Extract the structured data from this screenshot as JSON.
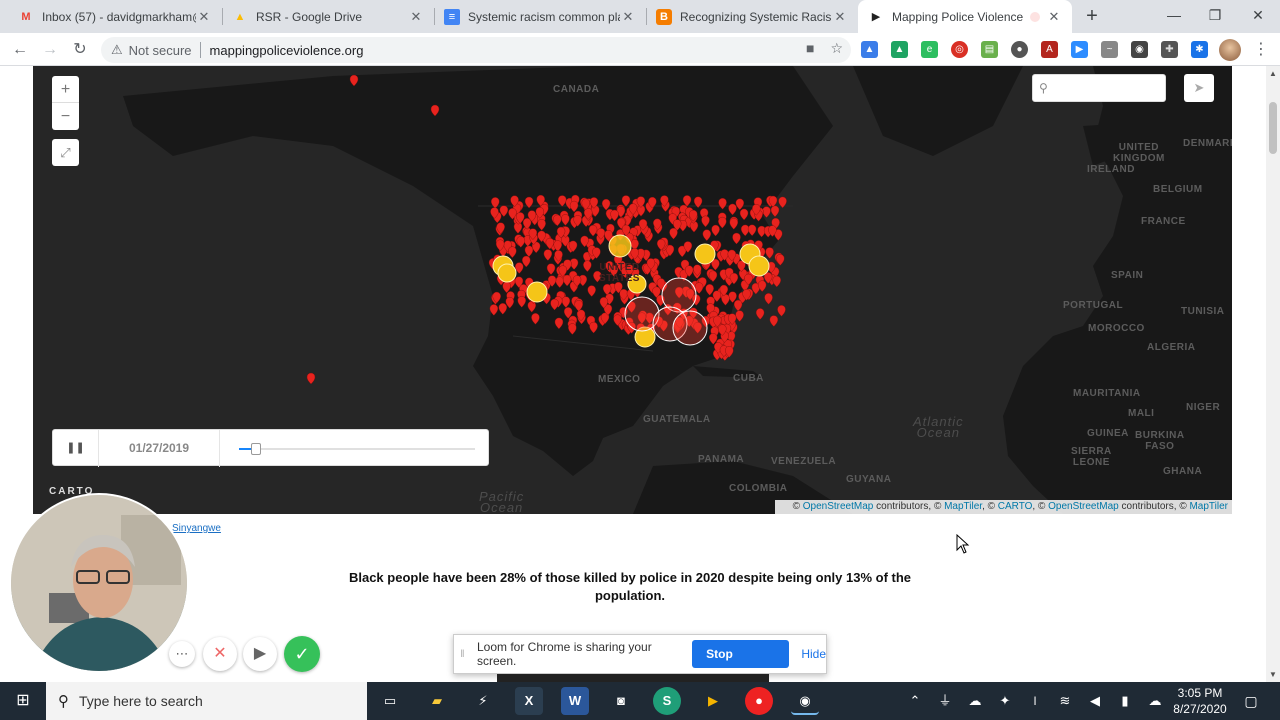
{
  "browser": {
    "tabs": [
      {
        "title": "Inbox (57) - davidgmarkham@",
        "icon": "gmail-icon",
        "favicon_text": "M",
        "favicon_color": "#ea4335"
      },
      {
        "title": "RSR - Google Drive",
        "icon": "google-drive-icon",
        "favicon_text": "▲",
        "favicon_color": "#fbbc04"
      },
      {
        "title": "Systemic racism common plac",
        "icon": "google-docs-icon",
        "favicon_text": "≡",
        "favicon_color": "#4285f4"
      },
      {
        "title": "Recognizing Systemic Racism",
        "icon": "blogger-icon",
        "favicon_text": "B",
        "favicon_color": "#f57d00"
      },
      {
        "title": "Mapping Police Violence",
        "icon": "mapping-police-violence-icon",
        "favicon_text": "▶",
        "favicon_color": "#222222",
        "active": true
      }
    ],
    "security_label": "Not secure",
    "url": "mappingpoliceviolence.org"
  },
  "map": {
    "labels": {
      "canada": "CANADA",
      "united_kingdom": "UNITED\nKINGDOM",
      "ireland": "IRELAND",
      "denmark": "DENMARK",
      "belgium": "BELGIUM",
      "france": "FRANCE",
      "spain": "SPAIN",
      "portugal": "PORTUGAL",
      "morocco": "MOROCCO",
      "algeria": "ALGERIA",
      "tunisia": "TUNISIA",
      "mauritania": "MAURITANIA",
      "mali": "MALI",
      "niger": "NIGER",
      "burkina_faso": "BURKINA\nFASO",
      "guinea": "GUINEA",
      "sierra_leone": "SIERRA\nLEONE",
      "ghana": "GHANA",
      "united_states": "UNITED\nSTATES",
      "mexico": "MEXICO",
      "cuba": "CUBA",
      "guatemala": "GUATEMALA",
      "panama": "PANAMA",
      "venezuela": "VENEZUELA",
      "guyana": "GUYANA",
      "colombia": "COLOMBIA",
      "atlantic_ocean": "Atlantic\nOcean",
      "pacific_ocean": "Pacific\nOcean"
    },
    "timeline_date": "01/27/2019",
    "timeline_progress": 0.07,
    "carto_logo": "CARTO",
    "attribution": {
      "osm1": "OpenStreetMap",
      "t1": " contributors, © ",
      "maptiler1": "MapTiler",
      "t2": ", © ",
      "carto": "CARTO",
      "t3": ", © ",
      "osm2": "OpenStreetMap",
      "t4": " contributors, © ",
      "maptiler2": "MapTiler",
      "prefix": "© "
    },
    "marker_color": "#e8231e",
    "cluster_color": "#f5c518"
  },
  "page": {
    "credit_link": "Sinyangwe",
    "headline": "Black people have been 28% of those killed by police in 2020 despite being only 13% of the population."
  },
  "loom": {
    "message": "Loom for Chrome is sharing your screen.",
    "stop_label": "Stop sharing",
    "hide_label": "Hide"
  },
  "taskbar": {
    "search_placeholder": "Type here to search",
    "time": "3:05 PM",
    "date": "8/27/2020"
  }
}
